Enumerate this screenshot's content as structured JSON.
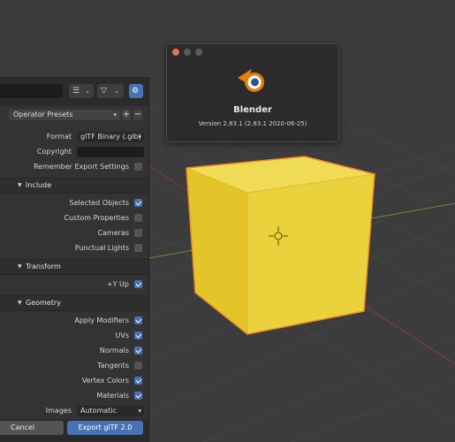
{
  "about": {
    "title": "Blender",
    "version": "Version 2.83.1 (2.83.1 2020-06-25)"
  },
  "toolbar": {
    "view_icon": "list-view-icon",
    "filter_icon": "filter-icon",
    "settings_icon": "gear-icon"
  },
  "presets": {
    "label": "Operator Presets",
    "add": "+",
    "remove": "−"
  },
  "fields": {
    "format_label": "Format",
    "format_value": "glTF Binary (.glb)",
    "copyright_label": "Copyright",
    "copyright_value": "",
    "remember_label": "Remember Export Settings",
    "remember_checked": false
  },
  "sections": {
    "include": "Include",
    "transform": "Transform",
    "geometry": "Geometry"
  },
  "include": [
    {
      "label": "Selected Objects",
      "checked": true
    },
    {
      "label": "Custom Properties",
      "checked": false
    },
    {
      "label": "Cameras",
      "checked": false
    },
    {
      "label": "Punctual Lights",
      "checked": false
    }
  ],
  "transform": [
    {
      "label": "+Y Up",
      "checked": true
    }
  ],
  "geometry": [
    {
      "label": "Apply Modifiers",
      "checked": true
    },
    {
      "label": "UVs",
      "checked": true
    },
    {
      "label": "Normals",
      "checked": true
    },
    {
      "label": "Tangents",
      "checked": false
    },
    {
      "label": "Vertex Colors",
      "checked": true
    },
    {
      "label": "Materials",
      "checked": true
    }
  ],
  "images": {
    "label": "Images",
    "value": "Automatic"
  },
  "buttons": {
    "cancel": "Cancel",
    "export": "Export glTF 2.0"
  },
  "colors": {
    "accent": "#4772b3",
    "cube": "#e8c930",
    "cube_outline": "#f08a24"
  }
}
